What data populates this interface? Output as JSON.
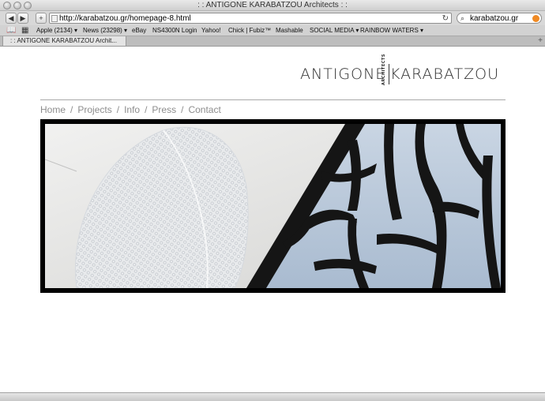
{
  "window": {
    "title": ": : ANTIGONE KARABATZOU Architects : :"
  },
  "toolbar": {
    "back_label": "◀",
    "forward_label": "▶",
    "add_label": "+",
    "url": "http://karabatzou.gr/homepage-8.html",
    "reload_icon": "reload-icon",
    "search_value": "karabatzou.gr"
  },
  "bookmarks": [
    {
      "label": "Apple (2134) ▾"
    },
    {
      "label": "News (23298) ▾"
    },
    {
      "label": "eBay"
    },
    {
      "label": "NS4300N Login"
    },
    {
      "label": "Yahoo!"
    },
    {
      "label": "Chick | Fubiz™"
    },
    {
      "label": "Mashable"
    },
    {
      "label": "SOCIAL MEDIA ▾"
    },
    {
      "label": "RAINBOW WATERS ▾"
    }
  ],
  "tab": {
    "label": ": : ANTIGONE KARABATZOU Archit..."
  },
  "site": {
    "logo_left": "ANTIGONE",
    "logo_right": "KARABATZOU",
    "logo_sub": "ARCHITECTS",
    "nav": [
      {
        "label": "Home"
      },
      {
        "label": "Projects"
      },
      {
        "label": "Info"
      },
      {
        "label": "Press"
      },
      {
        "label": "Contact"
      }
    ],
    "nav_separator": "/"
  },
  "colors": {
    "accent_orange": "#f08a24",
    "nav_text": "#8d8d8d",
    "sky_blue": "#b9c8da"
  }
}
